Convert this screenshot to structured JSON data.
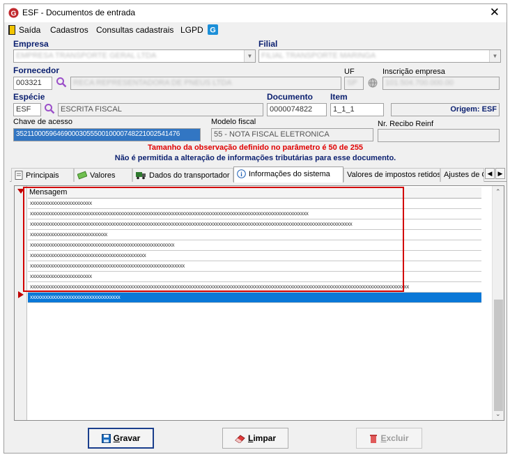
{
  "window": {
    "title": "ESF - Documentos de entrada"
  },
  "menu": [
    "Saída",
    "Cadastros",
    "Consultas cadastrais",
    "LGPD"
  ],
  "form": {
    "empresa_label": "Empresa",
    "empresa_value": "EMPRESA TRANSPORTE GERAL LTDA",
    "filial_label": "Filial",
    "filial_value": "FILIAL TRANSPORTE MARINGA",
    "fornecedor_label": "Fornecedor",
    "fornecedor_code": "003321",
    "fornecedor_name": "RECA REPRESENTADORA DE PNEUS LTDA",
    "uf_label": "UF",
    "uf_value": "SP",
    "inscricao_label": "Inscrição empresa",
    "inscricao_value": "101.504.700.000.00",
    "especie_label": "Espécie",
    "especie_code": "ESF",
    "especie_name": "ESCRITA FISCAL",
    "documento_label": "Documento",
    "documento_value": "0000074822",
    "item_label": "Item",
    "item_value": "1_1_1",
    "origem_text": "Origem: ESF",
    "chave_label": "Chave de acesso",
    "chave_value": "35211000596469000305550010000748221002541476",
    "modelo_label": "Modelo fiscal",
    "modelo_value": "55 - NOTA FISCAL ELETRONICA",
    "recibo_label": "Nr. Recibo Reinf",
    "recibo_value": ""
  },
  "warnings": {
    "line1": "Tamanho da observação definido no parâmetro é 50 de 255",
    "line2": "Não é permitida a alteração de informações tributárias para esse documento."
  },
  "tabs": [
    "Principais",
    "Valores",
    "Dados do transportador",
    "Informações do sistema",
    "Valores de impostos retidos",
    "Ajustes de C"
  ],
  "grid": {
    "header": "Mensagem",
    "rows": [
      "xxxxxxxxxxxxxxxxxxxxxxxx",
      "xxxxxxxxxxxxxxxxxxxxxxxxxxxxxxxxxxxxxxxxxxxxxxxxxxxxxxxxxxxxxxxxxxxxxxxxxxxxxxxxxxxxxxxxxxxxxxxxxxxxxxxxxxxx",
      "xxxxxxxxxxxxxxxxxxxxxxxxxxxxxxxxxxxxxxxxxxxxxxxxxxxxxxxxxxxxxxxxxxxxxxxxxxxxxxxxxxxxxxxxxxxxxxxxxxxxxxxxxxxxxxxxxxxxxxxxxxxxx",
      "xxxxxxxxxxxxxxxxxxxxxxxxxxxxxx",
      "xxxxxxxxxxxxxxxxxxxxxxxxxxxxxxxxxxxxxxxxxxxxxxxxxxxxxxxx",
      "xxxxxxxxxxxxxxxxxxxxxxxxxxxxxxxxxxxxxxxxxxxxx",
      "xxxxxxxxxxxxxxxxxxxxxxxxxxxxxxxxxxxxxxxxxxxxxxxxxxxxxxxxxxxx",
      "xxxxxxxxxxxxxxxxxxxxxxxx",
      "xxxxxxxxxxxxxxxxxxxxxxxxxxxxxxxxxxxxxxxxxxxxxxxxxxxxxxxxxxxxxxxxxxxxxxxxxxxxxxxxxxxxxxxxxxxxxxxxxxxxxxxxxxxxxxxxxxxxxxxxxxxxxxxxxxxxxxxxxxxxxxxxxxx",
      "xxxxxxxxxxxxxxxxxxxxxxxxxxxxxxxxxxx"
    ]
  },
  "buttons": {
    "gravar_first": "G",
    "gravar_rest": "ravar",
    "limpar_first": "L",
    "limpar_rest": "impar",
    "excluir_first": "E",
    "excluir_rest": "xcluir"
  },
  "colors": {
    "label_blue": "#0a1f6f",
    "warning_red": "#e00000",
    "selection_blue": "#0a78d7",
    "highlight_red": "#d20000"
  }
}
